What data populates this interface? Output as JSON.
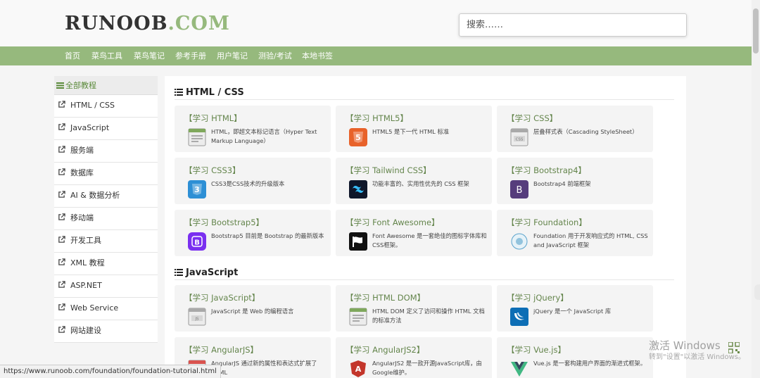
{
  "header": {
    "logo_part1": "RUNOOB",
    "logo_part2": ".COM",
    "search_placeholder": "搜索……"
  },
  "nav": {
    "items": [
      "首页",
      "菜鸟工具",
      "菜鸟笔记",
      "参考手册",
      "用户笔记",
      "测验/考试",
      "本地书签"
    ]
  },
  "sidebar": {
    "heading": "全部教程",
    "items": [
      "HTML / CSS",
      "JavaScript",
      "服务端",
      "数据库",
      "AI & 数据分析",
      "移动端",
      "开发工具",
      "XML 教程",
      "ASP.NET",
      "Web Service",
      "网站建设"
    ]
  },
  "sections": [
    {
      "title": "HTML / CSS",
      "cards": [
        {
          "title": "【学习 HTML】",
          "desc": "HTML，即超文本标记语言（Hyper Text Markup Language）",
          "icon": "html-doc-icon"
        },
        {
          "title": "【学习 HTML5】",
          "desc": "HTML5 是下一代 HTML 标准",
          "icon": "html5-icon"
        },
        {
          "title": "【学习 CSS】",
          "desc": "层叠样式表（Cascading StyleSheet）",
          "icon": "css-doc-icon"
        },
        {
          "title": "【学习 CSS3】",
          "desc": "CSS3是CSS技术的升级版本",
          "icon": "css3-icon"
        },
        {
          "title": "【学习 Tailwind CSS】",
          "desc": "功能丰富的、实用性优先的 CSS 框架",
          "icon": "tailwind-icon"
        },
        {
          "title": "【学习 Bootstrap4】",
          "desc": "Bootstrap4 前端框架",
          "icon": "bootstrap4-icon"
        },
        {
          "title": "【学习 Bootstrap5】",
          "desc": "Bootstrap5 目前是 Bootstrap 的最新版本",
          "icon": "bootstrap5-icon"
        },
        {
          "title": "【学习 Font Awesome】",
          "desc": "Font Awesome 是一套绝佳的图标字体库和CSS框架。",
          "icon": "font-awesome-flag-icon"
        },
        {
          "title": "【学习 Foundation】",
          "desc": "Foundation 用于开发响应式的 HTML, CSS and JavaScript 框架",
          "icon": "foundation-icon"
        }
      ]
    },
    {
      "title": "JavaScript",
      "cards": [
        {
          "title": "【学习 JavaScript】",
          "desc": "JavaScript 是 Web 的编程语言",
          "icon": "js-doc-icon"
        },
        {
          "title": "【学习 HTML DOM】",
          "desc": "HTML DOM 定义了访问和操作 HTML 文档的标准方法",
          "icon": "dom-doc-icon"
        },
        {
          "title": "【学习 jQuery】",
          "desc": "jQuery 是一个 JavaScript 库",
          "icon": "jquery-icon"
        },
        {
          "title": "【学习 AngularJS】",
          "desc": "AngularJS 通过新的属性和表达式扩展了 HTML",
          "icon": "angularjs-icon"
        },
        {
          "title": "【学习 AngularJS2】",
          "desc": "AngularJS2 是一款开源JavaScript库，由Google维护。",
          "icon": "angular2-icon"
        },
        {
          "title": "【学习 Vue.js】",
          "desc": "Vue.js 是一套构建用户界面的渐进式框架。",
          "icon": "vue-icon"
        }
      ]
    }
  ],
  "status_url": "https://www.runoob.com/foundation/foundation-tutorial.html",
  "watermark": {
    "line1": "激活 Windows",
    "line2": "转到\"设置\"以激活 Windows。"
  },
  "colors": {
    "accent": "#96b97d",
    "card_title": "#64854c",
    "card_bg": "#f4f4f4"
  }
}
